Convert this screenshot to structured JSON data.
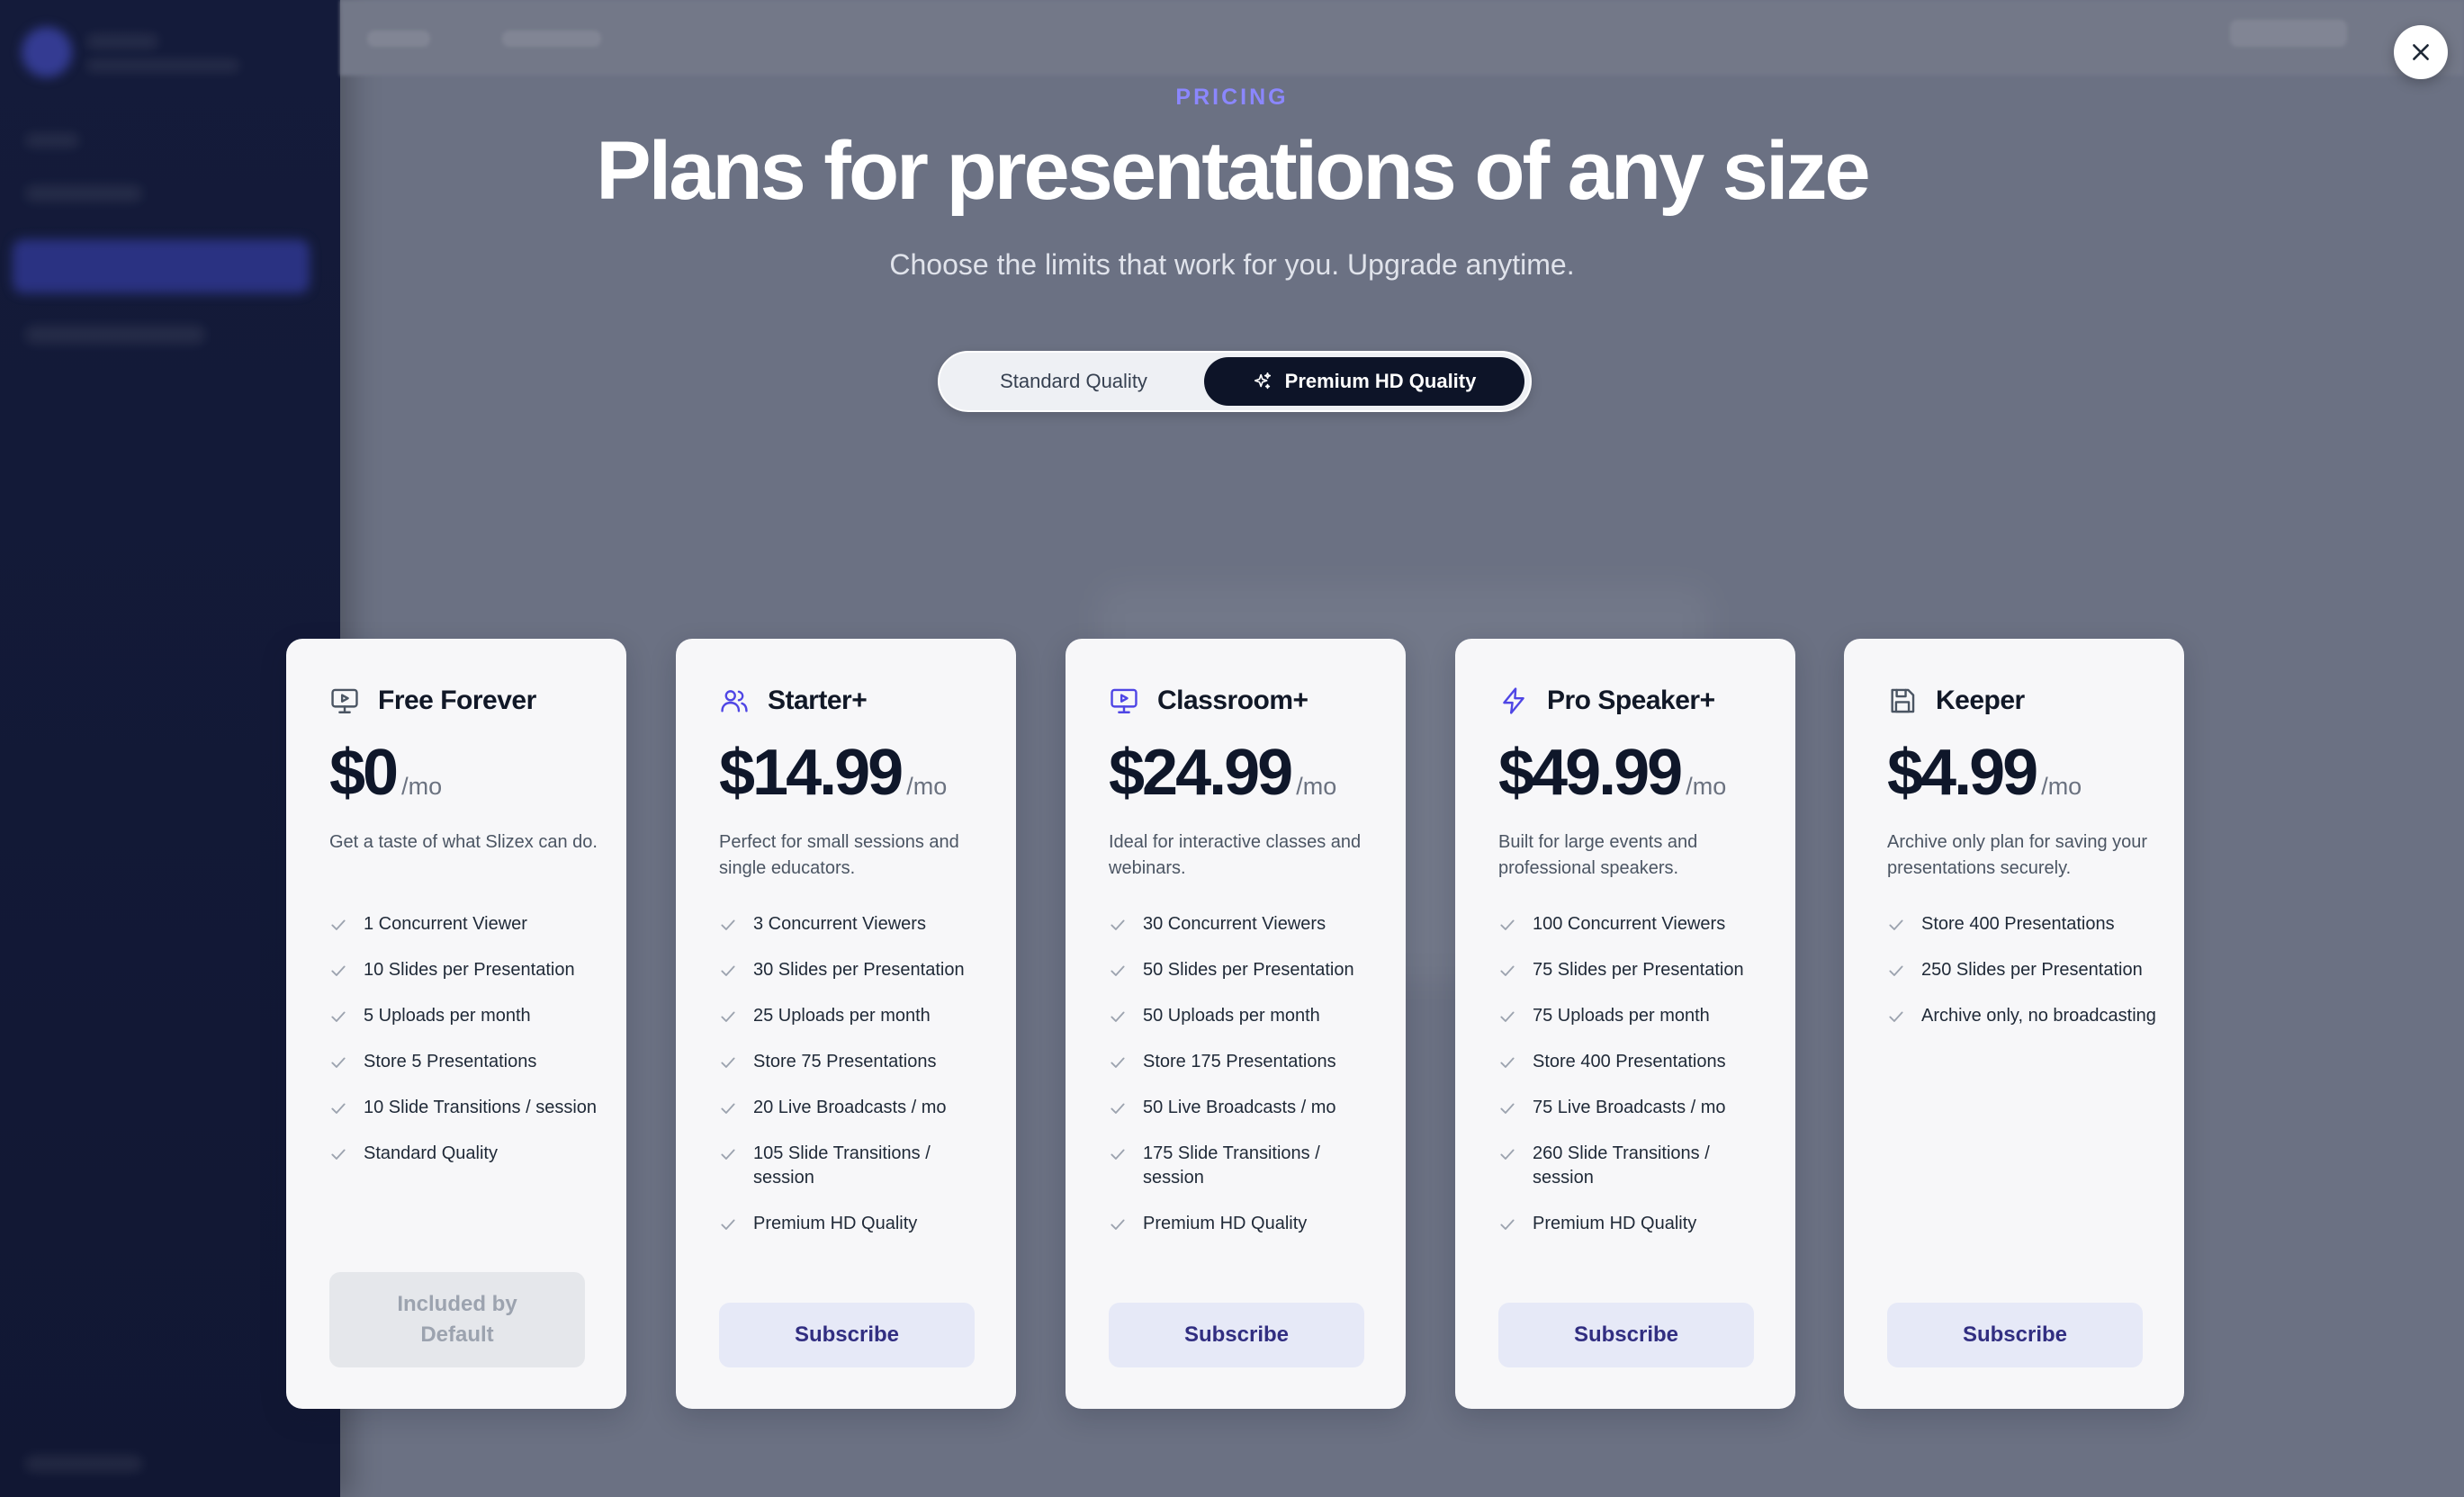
{
  "header": {
    "eyebrow": "PRICING",
    "title": "Plans for presentations of any size",
    "subtitle": "Choose the limits that work for you. Upgrade anytime."
  },
  "toggle": {
    "options": [
      {
        "label": "Standard Quality",
        "selected": false
      },
      {
        "label": "Premium HD Quality",
        "selected": true,
        "icon": "sparkles-icon"
      }
    ]
  },
  "close": {
    "icon": "close-icon"
  },
  "colors": {
    "accent": "#8b87ff",
    "dark": "#0d1428",
    "button_bg": "#e6e9f7",
    "button_text": "#312e81"
  },
  "plans": [
    {
      "name": "Free Forever",
      "icon": "monitor-play-icon",
      "price": "$0",
      "per": "/mo",
      "description": "Get a taste of what Slizex can do.",
      "features": [
        "1 Concurrent Viewer",
        "10 Slides per Presentation",
        "5 Uploads per month",
        "Store 5 Presentations",
        "10 Slide Transitions / session",
        "Standard Quality"
      ],
      "cta": "Included by Default",
      "cta_enabled": false
    },
    {
      "name": "Starter+",
      "icon": "users-icon",
      "price": "$14.99",
      "per": "/mo",
      "description": "Perfect for small sessions and single educators.",
      "features": [
        "3 Concurrent Viewers",
        "30 Slides per Presentation",
        "25 Uploads per month",
        "Store 75 Presentations",
        "20 Live Broadcasts / mo",
        "105 Slide Transitions / session",
        "Premium HD Quality"
      ],
      "cta": "Subscribe",
      "cta_enabled": true
    },
    {
      "name": "Classroom+",
      "icon": "presentation-icon",
      "price": "$24.99",
      "per": "/mo",
      "description": "Ideal for interactive classes and webinars.",
      "features": [
        "30 Concurrent Viewers",
        "50 Slides per Presentation",
        "50 Uploads per month",
        "Store 175 Presentations",
        "50 Live Broadcasts / mo",
        "175 Slide Transitions / session",
        "Premium HD Quality"
      ],
      "cta": "Subscribe",
      "cta_enabled": true
    },
    {
      "name": "Pro Speaker+",
      "icon": "lightning-icon",
      "price": "$49.99",
      "per": "/mo",
      "description": "Built for large events and professional speakers.",
      "features": [
        "100 Concurrent Viewers",
        "75 Slides per Presentation",
        "75 Uploads per month",
        "Store 400 Presentations",
        "75 Live Broadcasts / mo",
        "260 Slide Transitions / session",
        "Premium HD Quality"
      ],
      "cta": "Subscribe",
      "cta_enabled": true
    },
    {
      "name": "Keeper",
      "icon": "save-icon",
      "price": "$4.99",
      "per": "/mo",
      "description": "Archive only plan for saving your presentations securely.",
      "features": [
        "Store 400 Presentations",
        "250 Slides per Presentation",
        "Archive only, no broadcasting"
      ],
      "cta": "Subscribe",
      "cta_enabled": true
    }
  ]
}
